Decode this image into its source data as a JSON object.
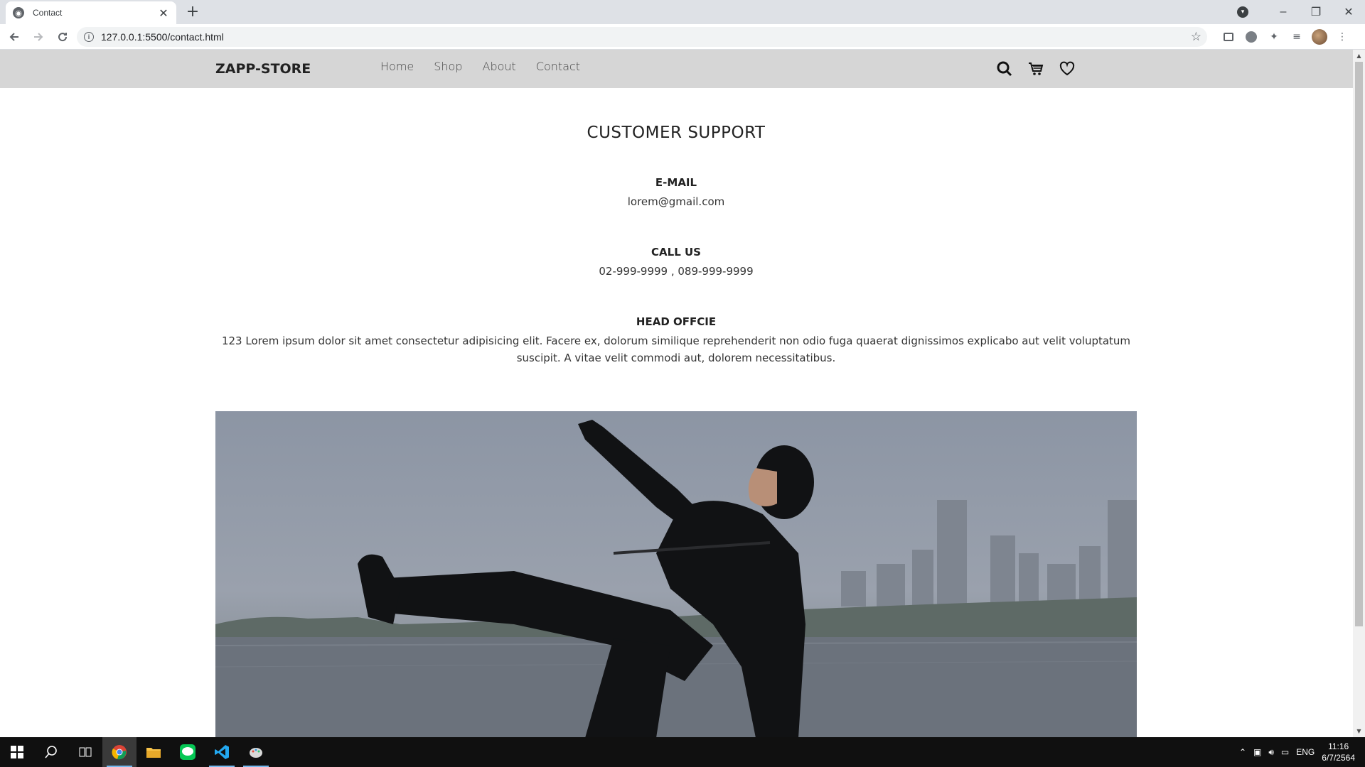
{
  "browser": {
    "tab_title": "Contact",
    "url": "127.0.0.1:5500/contact.html"
  },
  "site": {
    "brand": "ZAPP-STORE",
    "menu": [
      {
        "label": "Home"
      },
      {
        "label": "Shop"
      },
      {
        "label": "About"
      },
      {
        "label": "Contact"
      }
    ],
    "icons": [
      "search-icon",
      "cart-icon",
      "heart-icon"
    ]
  },
  "page": {
    "title": "CUSTOMER SUPPORT",
    "email_heading": "E-MAIL",
    "email_value": "lorem@gmail.com",
    "call_heading": "CALL US",
    "call_value": "02-999-9999 , 089-999-9999",
    "office_heading": "HEAD OFFCIE",
    "office_value": "123 Lorem ipsum dolor sit amet consectetur adipisicing elit. Facere ex, dolorum similique reprehenderit non odio fuga quaerat dignissimos explicabo aut velit voluptatum suscipit. A vitae velit commodi aut, dolorem necessitatibus."
  },
  "taskbar": {
    "lang": "ENG",
    "time": "11:16",
    "date": "6/7/2564"
  }
}
